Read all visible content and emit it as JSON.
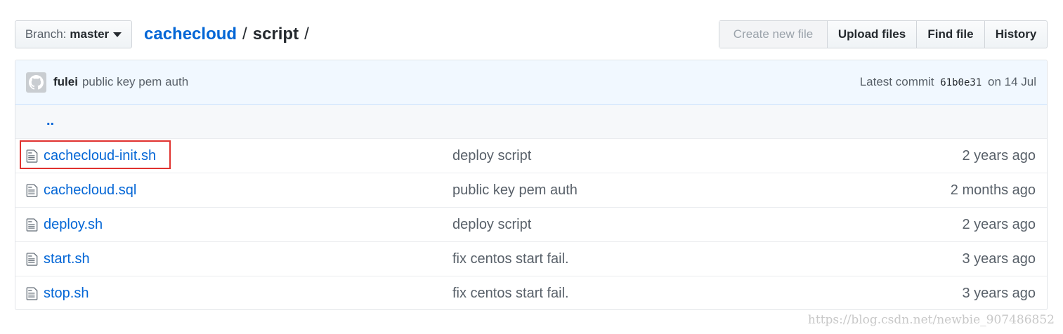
{
  "branch": {
    "label": "Branch:",
    "value": "master"
  },
  "breadcrumb": {
    "repo": "cachecloud",
    "separator": "/",
    "dir": "script",
    "trailing": "/"
  },
  "actions": {
    "create_new_file": "Create new file",
    "upload_files": "Upload files",
    "find_file": "Find file",
    "history": "History"
  },
  "commit": {
    "author": "fulei",
    "message": "public key pem auth",
    "latest_label": "Latest commit",
    "sha": "61b0e31",
    "date": "on 14 Jul"
  },
  "parent_link": "..",
  "files": [
    {
      "name": "cachecloud-init.sh",
      "message": "deploy script",
      "age": "2 years ago",
      "highlighted": true
    },
    {
      "name": "cachecloud.sql",
      "message": "public key pem auth",
      "age": "2 months ago"
    },
    {
      "name": "deploy.sh",
      "message": "deploy script",
      "age": "2 years ago"
    },
    {
      "name": "start.sh",
      "message": "fix centos start fail.",
      "age": "3 years ago"
    },
    {
      "name": "stop.sh",
      "message": "fix centos start fail.",
      "age": "3 years ago"
    }
  ],
  "watermark": "https://blog.csdn.net/newbie_907486852",
  "colors": {
    "link": "#0366d6",
    "highlight": "#e0322f",
    "commit_bg": "#f1f8ff"
  },
  "icons": {
    "file": "file-text-icon",
    "avatar": "github-octocat-icon",
    "caret": "caret-down-icon"
  }
}
